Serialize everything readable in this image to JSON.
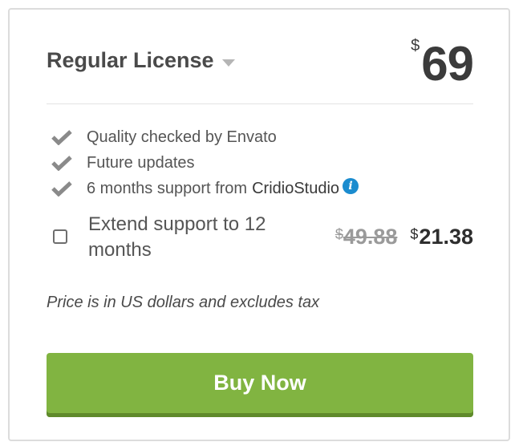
{
  "license": {
    "title": "Regular License",
    "currency_symbol": "$",
    "price": "69"
  },
  "features": [
    {
      "text": "Quality checked by Envato",
      "icon": "check-icon"
    },
    {
      "text": "Future updates",
      "icon": "check-icon"
    },
    {
      "text": "6 months support from",
      "author": "CridioStudio",
      "icon": "check-icon",
      "info_icon": "info-icon"
    }
  ],
  "info_icon_glyph": "i",
  "extend_support": {
    "checked": false,
    "label": "Extend support to 12 months",
    "old_currency": "$",
    "old_price": "49.88",
    "new_currency": "$",
    "new_price": "21.38"
  },
  "price_note": "Price is in US dollars and excludes tax",
  "buy_button_label": "Buy Now",
  "colors": {
    "buy_button": "#81b441",
    "buy_button_shadow": "#5f8a2b",
    "info_icon": "#1b8ccf",
    "check_icon": "#8a8a8a"
  }
}
